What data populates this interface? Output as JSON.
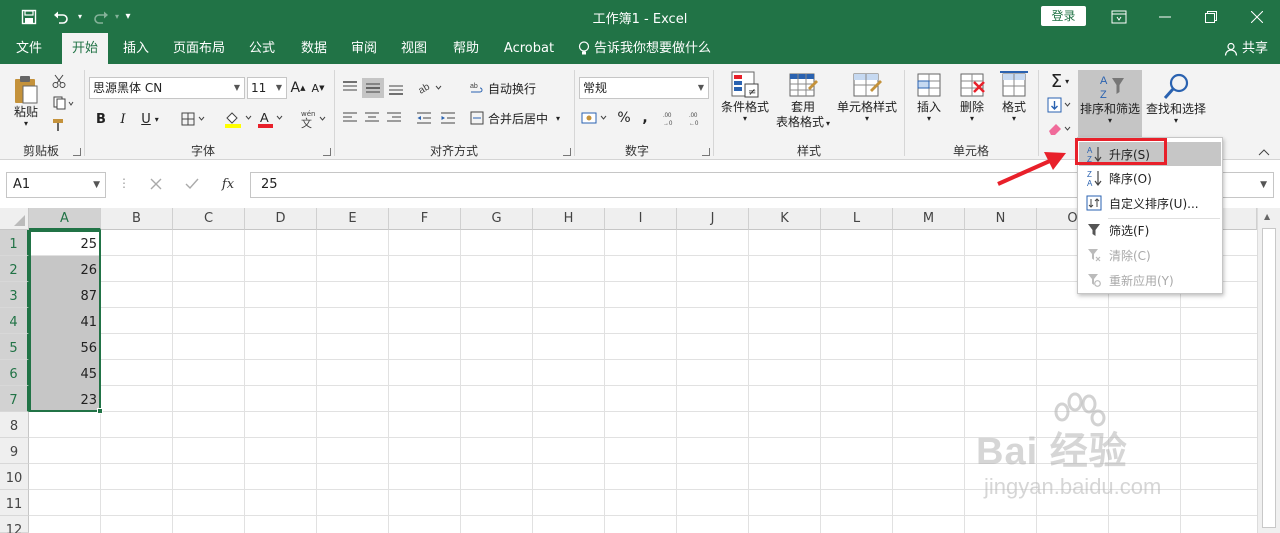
{
  "window": {
    "title": "工作簿1  -  Excel",
    "login_label": "登录"
  },
  "tabs": [
    {
      "label": "文件"
    },
    {
      "label": "开始"
    },
    {
      "label": "插入"
    },
    {
      "label": "页面布局"
    },
    {
      "label": "公式"
    },
    {
      "label": "数据"
    },
    {
      "label": "审阅"
    },
    {
      "label": "视图"
    },
    {
      "label": "帮助"
    },
    {
      "label": "Acrobat"
    }
  ],
  "tellme": "告诉我你想要做什么",
  "share": "共享",
  "ribbon": {
    "clipboard": {
      "paste": "粘贴",
      "label": "剪贴板"
    },
    "font": {
      "name": "思源黑体 CN",
      "size": "11",
      "label": "字体",
      "wen_label": "wén",
      "wen_char": "文"
    },
    "alignment": {
      "wrap": "自动换行",
      "merge": "合并后居中",
      "label": "对齐方式"
    },
    "number": {
      "format": "常规",
      "label": "数字"
    },
    "styles": {
      "conditional": "条件格式",
      "table_line1": "套用",
      "table_line2": "表格格式",
      "cell_styles": "单元格样式",
      "label": "样式"
    },
    "cells": {
      "insert": "插入",
      "delete": "删除",
      "format": "格式",
      "label": "单元格"
    },
    "editing": {
      "sort_filter": "排序和筛选",
      "find_select": "查找和选择"
    }
  },
  "formula_bar": {
    "name_box": "A1",
    "formula": "25"
  },
  "columns": [
    "A",
    "B",
    "C",
    "D",
    "E",
    "F",
    "G",
    "H",
    "I",
    "J",
    "K",
    "L",
    "M",
    "N",
    "O"
  ],
  "rows": [
    "1",
    "2",
    "3",
    "4",
    "5",
    "6",
    "7",
    "8",
    "9",
    "10",
    "11",
    "12"
  ],
  "column_a_values": [
    "25",
    "26",
    "87",
    "41",
    "56",
    "45",
    "23"
  ],
  "sort_menu": {
    "items": [
      {
        "label": "升序(S)",
        "enabled": true
      },
      {
        "label": "降序(O)",
        "enabled": true
      },
      {
        "label": "自定义排序(U)...",
        "enabled": true
      },
      {
        "label": "筛选(F)",
        "enabled": true
      },
      {
        "label": "清除(C)",
        "enabled": false
      },
      {
        "label": "重新应用(Y)",
        "enabled": false
      }
    ]
  },
  "watermark": {
    "main": "Bai 经验",
    "sub": "jingyan.baidu.com"
  },
  "colors": {
    "excel_green": "#217346",
    "highlight_red": "#e8202a",
    "ribbon_bg": "#f3f3f3"
  }
}
